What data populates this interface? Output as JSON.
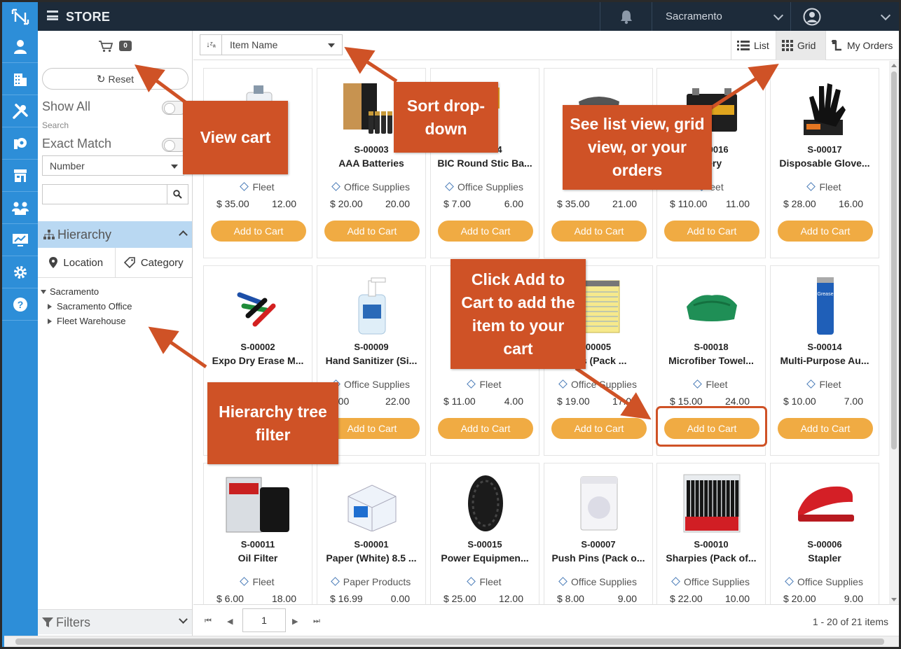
{
  "app": {
    "title": "STORE",
    "location": "Sacramento"
  },
  "sidebar": {
    "cart_count": "0",
    "reset_label": "Reset",
    "show_all_label": "Show All",
    "search_label": "Search",
    "exact_match_label": "Exact Match",
    "search_field_select": "Number",
    "search_value": "",
    "hierarchy_label": "Hierarchy",
    "tabs": [
      "Location",
      "Category"
    ],
    "tree": {
      "root": "Sacramento",
      "children": [
        "Sacramento Office",
        "Fleet Warehouse"
      ]
    },
    "filters_label": "Filters"
  },
  "toolbar": {
    "sort_value": "Item Name",
    "list_label": "List",
    "grid_label": "Grid",
    "orders_label": "My Orders"
  },
  "products": [
    {
      "sku": "",
      "name": "(...",
      "category": "Fleet",
      "price": "$ 35.00",
      "qty": "12.00",
      "img": "oil-bottle"
    },
    {
      "sku": "S-00003",
      "name": "AAA Batteries",
      "category": "Office Supplies",
      "price": "$ 20.00",
      "qty": "20.00",
      "img": "batteries"
    },
    {
      "sku": "S-00004",
      "name": "BIC Round Stic Ba...",
      "category": "Office Supplies",
      "price": "$ 7.00",
      "qty": "6.00",
      "img": "pens"
    },
    {
      "sku": "",
      "name": "",
      "category": "",
      "price": "$ 35.00",
      "qty": "21.00",
      "img": "brake-pads"
    },
    {
      "sku": "S-00016",
      "name": "ttery",
      "category": "eet",
      "price": "$ 110.00",
      "qty": "11.00",
      "img": "car-battery"
    },
    {
      "sku": "S-00017",
      "name": "Disposable Glove...",
      "category": "Fleet",
      "price": "$ 28.00",
      "qty": "16.00",
      "img": "gloves"
    },
    {
      "sku": "S-00002",
      "name": "Expo Dry Erase M...",
      "category": "",
      "price": "",
      "qty": "",
      "img": "markers"
    },
    {
      "sku": "S-00009",
      "name": "Hand Sanitizer (Si...",
      "category": "Office Supplies",
      "price": "4.00",
      "qty": "22.00",
      "img": "sanitizer"
    },
    {
      "sku": "",
      "name": "J",
      "category": "Fleet",
      "price": "$ 11.00",
      "qty": "4.00",
      "img": "none"
    },
    {
      "sku": "00005",
      "name": "ads (Pack ...",
      "category": "Office Supplies",
      "price": "$ 19.00",
      "qty": "17.00",
      "img": "legal-pads"
    },
    {
      "sku": "S-00018",
      "name": "Microfiber Towel...",
      "category": "Fleet",
      "price": "$ 15.00",
      "qty": "24.00",
      "img": "towels"
    },
    {
      "sku": "S-00014",
      "name": "Multi-Purpose Au...",
      "category": "Fleet",
      "price": "$ 10.00",
      "qty": "7.00",
      "img": "grease"
    },
    {
      "sku": "S-00011",
      "name": "Oil Filter",
      "category": "Fleet",
      "price": "$ 6.00",
      "qty": "18.00",
      "img": "oil-filter"
    },
    {
      "sku": "S-00001",
      "name": "Paper (White) 8.5 ...",
      "category": "Paper Products",
      "price": "$ 16.99",
      "qty": "0.00",
      "img": "paper-box"
    },
    {
      "sku": "S-00015",
      "name": "Power Equipmen...",
      "category": "Fleet",
      "price": "$ 25.00",
      "qty": "12.00",
      "img": "tire"
    },
    {
      "sku": "S-00007",
      "name": "Push Pins (Pack o...",
      "category": "Office Supplies",
      "price": "$ 8.00",
      "qty": "9.00",
      "img": "push-pins"
    },
    {
      "sku": "S-00010",
      "name": "Sharpies (Pack of...",
      "category": "Office Supplies",
      "price": "$ 22.00",
      "qty": "10.00",
      "img": "sharpies"
    },
    {
      "sku": "S-00006",
      "name": "Stapler",
      "category": "Office Supplies",
      "price": "$ 20.00",
      "qty": "9.00",
      "img": "stapler"
    }
  ],
  "add_to_cart_label": "Add to Cart",
  "pager": {
    "page": "1",
    "info": "1 - 20 of 21 items"
  },
  "callouts": {
    "view_cart": "View cart",
    "sort": "Sort drop-down",
    "views": "See list view, grid view, or your orders",
    "add_cart": "Click Add to Cart to add the item to your cart",
    "hierarchy": "Hierarchy tree filter"
  },
  "colors": {
    "accent": "#2d8ed8",
    "topbar": "#1d2b3a",
    "button": "#f0ab43",
    "callout": "#cf5226"
  }
}
